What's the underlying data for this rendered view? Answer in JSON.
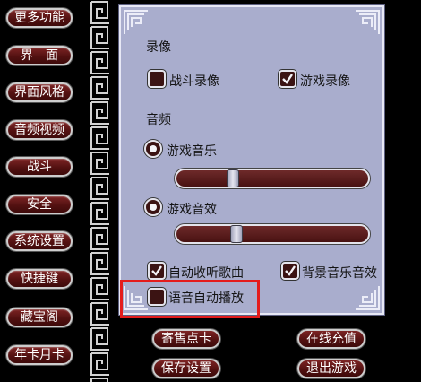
{
  "menu": {
    "items": [
      {
        "label": "更多功能"
      },
      {
        "label": "界　面"
      },
      {
        "label": "界面风格"
      },
      {
        "label": "音频视频"
      },
      {
        "label": "战斗"
      },
      {
        "label": "安全"
      },
      {
        "label": "系统设置"
      },
      {
        "label": "快捷键"
      },
      {
        "label": "藏宝阁"
      },
      {
        "label": "年卡月卡"
      }
    ]
  },
  "settings": {
    "recording": {
      "title": "录像",
      "battle_recording": {
        "label": "战斗录像",
        "checked": false
      },
      "game_recording": {
        "label": "游戏录像",
        "checked": true
      }
    },
    "audio": {
      "title": "音频",
      "music": {
        "label": "游戏音乐",
        "selected": true,
        "level": 0.28
      },
      "sound_effects": {
        "label": "游戏音效",
        "selected": true,
        "level": 0.3
      },
      "auto_collect_songs": {
        "label": "自动收听歌曲",
        "checked": true
      },
      "bg_music_sound": {
        "label": "背景音乐音效",
        "checked": true
      },
      "voice_autoplay": {
        "label": "语音自动播放",
        "checked": false
      }
    }
  },
  "actions": {
    "consign": "寄售点卡",
    "recharge": "在线充值",
    "save": "保存设置",
    "exit": "退出游戏"
  },
  "colors": {
    "panel_bg": "#a9adcd",
    "button_red": "#5a1515",
    "highlight": "#e41c1c"
  }
}
